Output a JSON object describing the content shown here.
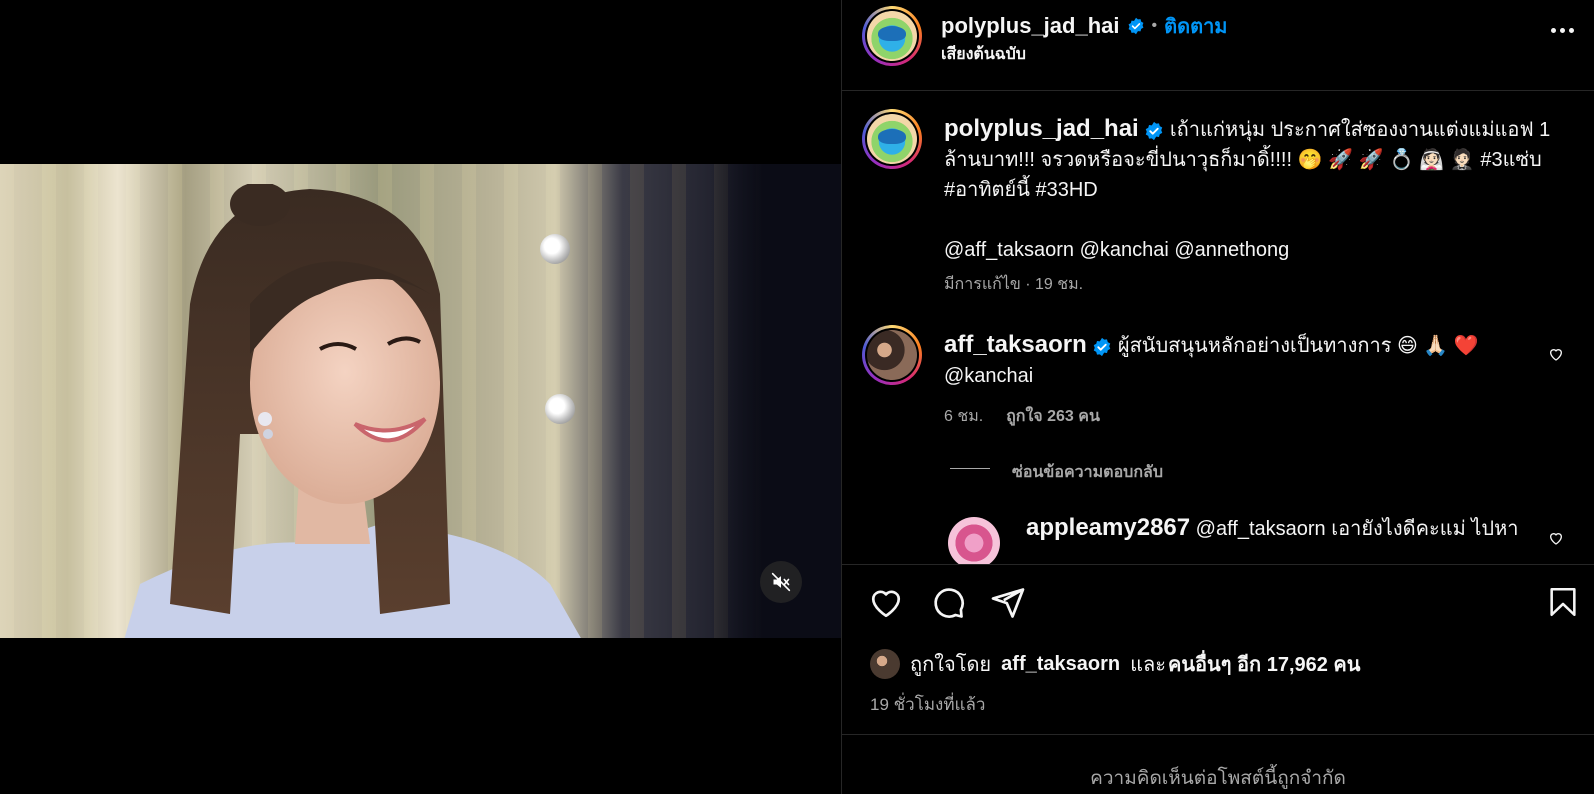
{
  "post": {
    "author": "polyplus_jad_hai",
    "follow_label": "ติดตาม",
    "separator": "•",
    "audio_label": "เสียงต้นฉบับ",
    "caption_text": "เถ้าแก่หนุ่ม ประกาศใส่ซองงานแต่งแม่แอฟ 1 ล้านบาท!!! จรวดหรือจะขี่ปนาวุธก็มาดิ้!!!! 🤭 🚀 🚀 💍 👰🏻 🤵🏻 #3แซ่บ #อาทิตย์นี้ #33HD",
    "caption_mentions": "@aff_taksaorn @kanchai @annethong",
    "caption_meta": "มีการแก้ไข · 19 ชม."
  },
  "comments": [
    {
      "username": "aff_taksaorn",
      "text": "ผู้สนับสนุนหลักอย่างเป็นทางการ 😄 🙏🏻 ❤️",
      "text_line2": "@kanchai",
      "time": "6 ชม.",
      "likes": "ถูกใจ 263 คน",
      "hide_replies": "ซ่อนข้อความตอบกลับ"
    },
    {
      "username": "appleamy2867",
      "text": "@aff_taksaorn เอายังไงดีคะแม่ ไปหา"
    }
  ],
  "engagement": {
    "liked_prefix": "ถูกใจโดย",
    "liked_user": "aff_taksaorn",
    "liked_and": "และ",
    "liked_others": "คนอื่นๆ อีก 17,962 คน",
    "posted_ago": "19 ชั่วโมงที่แล้ว"
  },
  "footer": {
    "comments_limited": "ความคิดเห็นต่อโพสต์นี้ถูกจำกัด"
  },
  "icons": {
    "verified_color": "#0095f6",
    "accent": "#0095f6"
  }
}
